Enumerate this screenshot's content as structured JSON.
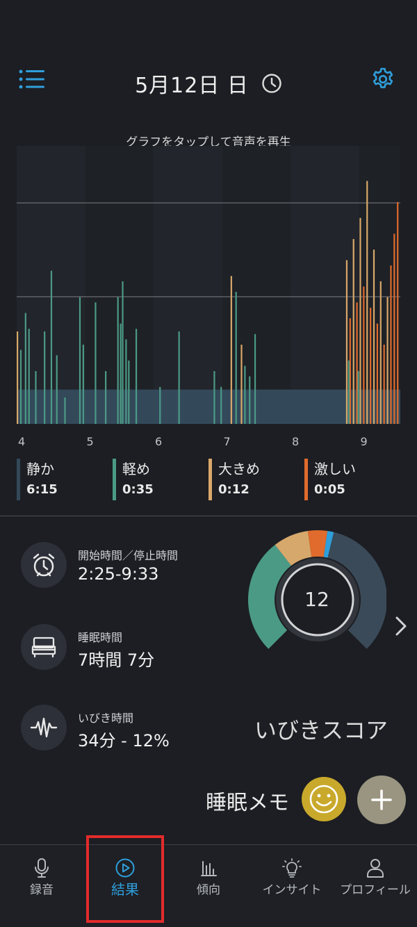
{
  "header": {
    "date_title": "5月12日 日",
    "hint": "グラフをタップして音声を再生"
  },
  "chart_data": {
    "type": "bar",
    "x_ticks": [
      "4",
      "5",
      "6",
      "7",
      "8",
      "9"
    ],
    "legend": [
      {
        "name": "静か",
        "duration": "6:15",
        "color": "#33495a"
      },
      {
        "name": "軽め",
        "duration": "0:35",
        "color": "#4b9a86"
      },
      {
        "name": "大きめ",
        "duration": "0:12",
        "color": "#d8a869"
      },
      {
        "name": "激しい",
        "duration": "0:05",
        "color": "#e06b2c"
      }
    ],
    "baseline_level": 0.13,
    "events": [
      {
        "t": 0.0,
        "level": 0.35,
        "cat": 2
      },
      {
        "t": 0.05,
        "level": 0.28,
        "cat": 1
      },
      {
        "t": 0.12,
        "level": 0.42,
        "cat": 1
      },
      {
        "t": 0.17,
        "level": 0.36,
        "cat": 1
      },
      {
        "t": 0.27,
        "level": 0.2,
        "cat": 1
      },
      {
        "t": 0.4,
        "level": 0.35,
        "cat": 1
      },
      {
        "t": 0.5,
        "level": 0.58,
        "cat": 1
      },
      {
        "t": 0.58,
        "level": 0.26,
        "cat": 1
      },
      {
        "t": 0.7,
        "level": 0.1,
        "cat": 1
      },
      {
        "t": 0.92,
        "level": 0.48,
        "cat": 1
      },
      {
        "t": 0.97,
        "level": 0.3,
        "cat": 1
      },
      {
        "t": 1.15,
        "level": 0.46,
        "cat": 1
      },
      {
        "t": 1.3,
        "level": 0.2,
        "cat": 1
      },
      {
        "t": 1.48,
        "level": 0.48,
        "cat": 1
      },
      {
        "t": 1.52,
        "level": 0.38,
        "cat": 1
      },
      {
        "t": 1.55,
        "level": 0.54,
        "cat": 1
      },
      {
        "t": 1.6,
        "level": 0.32,
        "cat": 1
      },
      {
        "t": 1.64,
        "level": 0.24,
        "cat": 1
      },
      {
        "t": 1.75,
        "level": 0.36,
        "cat": 1
      },
      {
        "t": 2.1,
        "level": 0.14,
        "cat": 1
      },
      {
        "t": 2.38,
        "level": 0.35,
        "cat": 1
      },
      {
        "t": 2.9,
        "level": 0.2,
        "cat": 1
      },
      {
        "t": 3.0,
        "level": 0.14,
        "cat": 1
      },
      {
        "t": 3.15,
        "level": 0.56,
        "cat": 2
      },
      {
        "t": 3.22,
        "level": 0.5,
        "cat": 1
      },
      {
        "t": 3.3,
        "level": 0.3,
        "cat": 2
      },
      {
        "t": 3.35,
        "level": 0.22,
        "cat": 1
      },
      {
        "t": 3.42,
        "level": 0.18,
        "cat": 1
      },
      {
        "t": 3.5,
        "level": 0.34,
        "cat": 1
      },
      {
        "t": 4.85,
        "level": 0.62,
        "cat": 2
      },
      {
        "t": 4.9,
        "level": 0.4,
        "cat": 3
      },
      {
        "t": 4.95,
        "level": 0.7,
        "cat": 2
      },
      {
        "t": 5.0,
        "level": 0.46,
        "cat": 3
      },
      {
        "t": 5.05,
        "level": 0.78,
        "cat": 2
      },
      {
        "t": 5.1,
        "level": 0.52,
        "cat": 3
      },
      {
        "t": 5.15,
        "level": 0.92,
        "cat": 2
      },
      {
        "t": 5.2,
        "level": 0.44,
        "cat": 3
      },
      {
        "t": 5.25,
        "level": 0.66,
        "cat": 2
      },
      {
        "t": 5.3,
        "level": 0.38,
        "cat": 3
      },
      {
        "t": 5.35,
        "level": 0.54,
        "cat": 2
      },
      {
        "t": 5.4,
        "level": 0.3,
        "cat": 3
      },
      {
        "t": 5.45,
        "level": 0.48,
        "cat": 2
      },
      {
        "t": 5.5,
        "level": 0.6,
        "cat": 3
      },
      {
        "t": 5.55,
        "level": 0.72,
        "cat": 3
      },
      {
        "t": 5.6,
        "level": 0.84,
        "cat": 3
      },
      {
        "t": 4.88,
        "level": 0.24,
        "cat": 1
      },
      {
        "t": 5.02,
        "level": 0.2,
        "cat": 1
      }
    ],
    "x_range": [
      0,
      5.65
    ]
  },
  "stats": {
    "start_stop": {
      "label": "開始時間／停止時間",
      "value": "2:25-9:33"
    },
    "sleep": {
      "label": "睡眠時間",
      "value": "7時間 7分"
    },
    "snore": {
      "label": "いびき時間",
      "value": "34分 - 12%"
    }
  },
  "score": {
    "value": "12",
    "title": "いびきスコア",
    "segments": [
      {
        "frac": 0.45,
        "color": "#3a4a58"
      },
      {
        "frac": 0.36,
        "color": "#4b9a86"
      },
      {
        "frac": 0.11,
        "color": "#d6a86c"
      },
      {
        "frac": 0.06,
        "color": "#e06b2c"
      },
      {
        "frac": 0.02,
        "color": "#2f9fdc"
      }
    ]
  },
  "memo": {
    "label": "睡眠メモ"
  },
  "nav": {
    "items": [
      {
        "label": "録音"
      },
      {
        "label": "結果"
      },
      {
        "label": "傾向"
      },
      {
        "label": "インサイト"
      },
      {
        "label": "プロフィール"
      }
    ]
  }
}
